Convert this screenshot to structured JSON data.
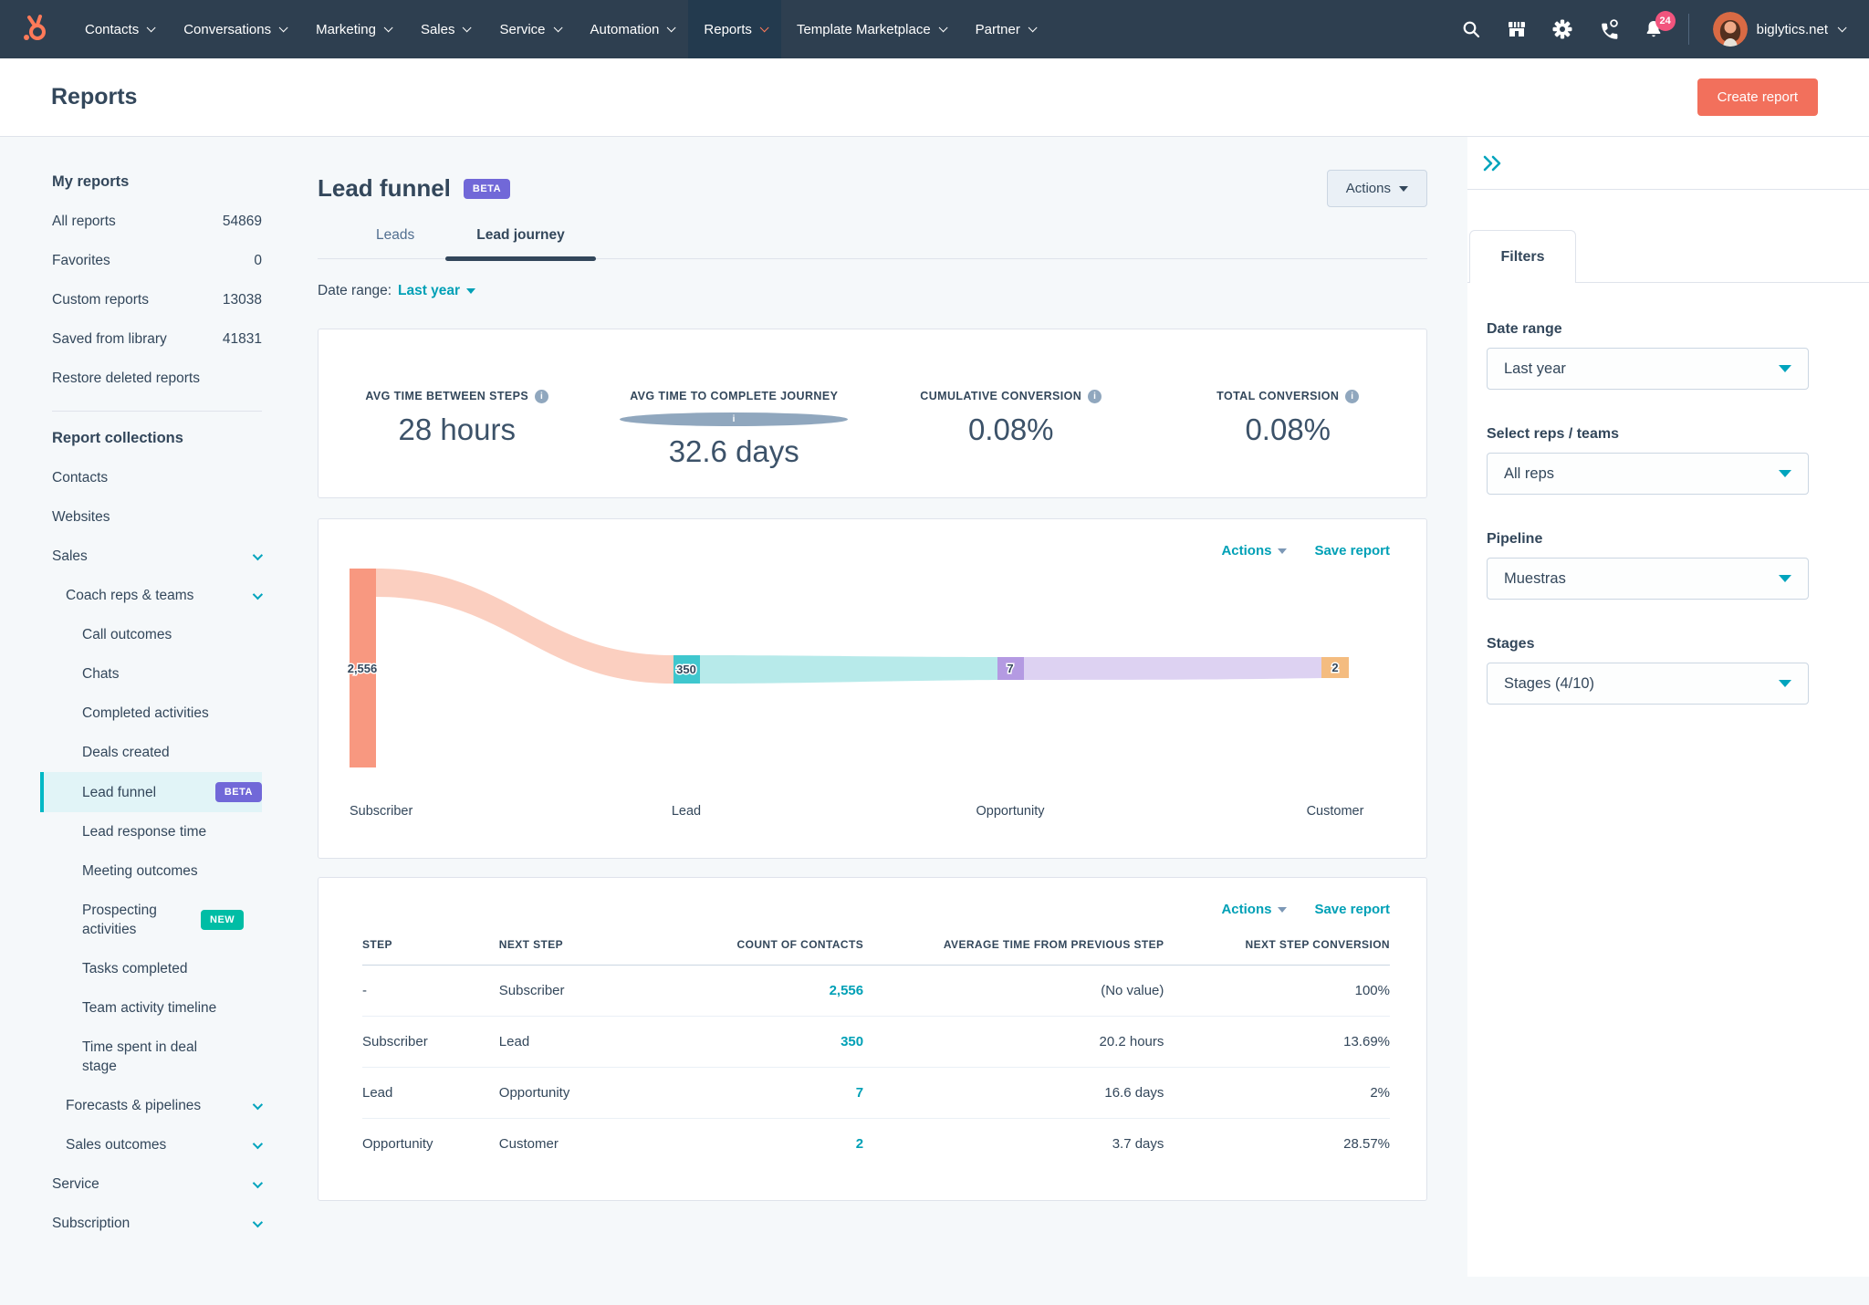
{
  "nav": {
    "items": [
      {
        "label": "Contacts"
      },
      {
        "label": "Conversations"
      },
      {
        "label": "Marketing"
      },
      {
        "label": "Sales"
      },
      {
        "label": "Service"
      },
      {
        "label": "Automation"
      },
      {
        "label": "Reports",
        "active": true
      },
      {
        "label": "Template Marketplace"
      },
      {
        "label": "Partner"
      }
    ],
    "notification_count": "24",
    "account_name": "biglytics.net"
  },
  "page_header": {
    "title": "Reports",
    "create_button": "Create report"
  },
  "sidebar": {
    "my_reports": {
      "heading": "My reports",
      "items": [
        {
          "label": "All reports",
          "count": "54869"
        },
        {
          "label": "Favorites",
          "count": "0"
        },
        {
          "label": "Custom reports",
          "count": "13038"
        },
        {
          "label": "Saved from library",
          "count": "41831"
        },
        {
          "label": "Restore deleted reports",
          "count": ""
        }
      ]
    },
    "collections": {
      "heading": "Report collections",
      "items": [
        {
          "label": "Contacts"
        },
        {
          "label": "Websites"
        },
        {
          "label": "Sales"
        },
        {
          "label": "Coach reps & teams"
        },
        {
          "label": "Call outcomes"
        },
        {
          "label": "Chats"
        },
        {
          "label": "Completed activities"
        },
        {
          "label": "Deals created"
        },
        {
          "label": "Lead funnel",
          "badge": "BETA"
        },
        {
          "label": "Lead response time"
        },
        {
          "label": "Meeting outcomes"
        },
        {
          "label": "Prospecting activities",
          "badge": "NEW"
        },
        {
          "label": "Tasks completed"
        },
        {
          "label": "Team activity timeline"
        },
        {
          "label": "Time spent in deal stage"
        },
        {
          "label": "Forecasts & pipelines"
        },
        {
          "label": "Sales outcomes"
        },
        {
          "label": "Service"
        },
        {
          "label": "Subscription"
        }
      ]
    }
  },
  "main": {
    "title": "Lead funnel",
    "beta_badge": "BETA",
    "actions_label": "Actions",
    "tabs": [
      {
        "label": "Leads"
      },
      {
        "label": "Lead journey",
        "active": true
      }
    ],
    "date_range_label": "Date range:",
    "date_range_value": "Last year",
    "metrics": [
      {
        "label": "AVG TIME BETWEEN STEPS",
        "value": "28 hours"
      },
      {
        "label": "AVG TIME TO COMPLETE JOURNEY",
        "value": "32.6 days"
      },
      {
        "label": "CUMULATIVE CONVERSION",
        "value": "0.08%"
      },
      {
        "label": "TOTAL CONVERSION",
        "value": "0.08%"
      }
    ],
    "chart_card": {
      "actions_label": "Actions",
      "save_label": "Save report"
    },
    "table_card": {
      "actions_label": "Actions",
      "save_label": "Save report",
      "columns": [
        "STEP",
        "NEXT STEP",
        "COUNT OF CONTACTS",
        "AVERAGE TIME FROM PREVIOUS STEP",
        "NEXT STEP CONVERSION"
      ],
      "rows": [
        {
          "step": "-",
          "next_step": "Subscriber",
          "count": "2,556",
          "avg_time": "(No value)",
          "conversion": "100%"
        },
        {
          "step": "Subscriber",
          "next_step": "Lead",
          "count": "350",
          "avg_time": "20.2 hours",
          "conversion": "13.69%"
        },
        {
          "step": "Lead",
          "next_step": "Opportunity",
          "count": "7",
          "avg_time": "16.6 days",
          "conversion": "2%"
        },
        {
          "step": "Opportunity",
          "next_step": "Customer",
          "count": "2",
          "avg_time": "3.7 days",
          "conversion": "28.57%"
        }
      ]
    }
  },
  "chart_data": {
    "type": "sankey-funnel",
    "stages": [
      "Subscriber",
      "Lead",
      "Opportunity",
      "Customer"
    ],
    "stage_totals": [
      2556,
      350,
      7,
      2
    ],
    "value_labels": [
      "2,556",
      "350",
      "7",
      "2"
    ],
    "links": [
      {
        "source": "Subscriber",
        "target": "Lead",
        "value": 350
      },
      {
        "source": "Lead",
        "target": "Opportunity",
        "value": 7
      },
      {
        "source": "Opportunity",
        "target": "Customer",
        "value": 2
      }
    ],
    "node_colors": [
      "#f89880",
      "#3fc7ce",
      "#b49ae2",
      "#f4bc80"
    ],
    "flow_colors": [
      "#fbcfc0",
      "#b7eaea",
      "#ddd2f2"
    ]
  },
  "filters_panel": {
    "tab_label": "Filters",
    "groups": [
      {
        "label": "Date range",
        "value": "Last year"
      },
      {
        "label": "Select reps / teams",
        "value": "All reps"
      },
      {
        "label": "Pipeline",
        "value": "Muestras"
      },
      {
        "label": "Stages",
        "value": "Stages (4/10)"
      }
    ]
  },
  "colors": {
    "nav_background": "#2e3f50",
    "accent_orange": "#f2705c",
    "link_teal": "#00a0b6",
    "text_navy": "#33475b",
    "beta_badge_purple": "#7168d8",
    "new_badge_green": "#00bda5",
    "notification_pink": "#f2547d",
    "selected_row_teal": "#00b8c5"
  }
}
